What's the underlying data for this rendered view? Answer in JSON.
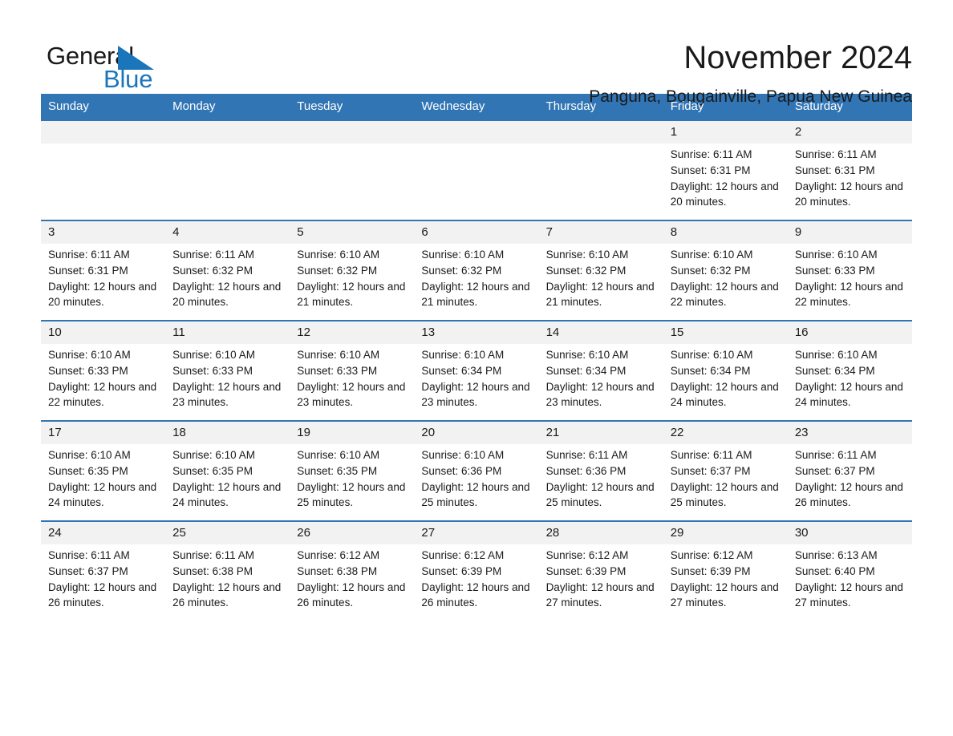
{
  "brand": {
    "name_part1": "General",
    "name_part2": "Blue",
    "triangle_color": "#1b75bb",
    "accent_color": "#3275b5"
  },
  "header": {
    "month_title": "November 2024",
    "location": "Panguna, Bougainville, Papua New Guinea"
  },
  "calendar": {
    "weekday_headers": [
      "Sunday",
      "Monday",
      "Tuesday",
      "Wednesday",
      "Thursday",
      "Friday",
      "Saturday"
    ],
    "weeks": [
      [
        {
          "day": "",
          "sunrise": "",
          "sunset": "",
          "daylight": ""
        },
        {
          "day": "",
          "sunrise": "",
          "sunset": "",
          "daylight": ""
        },
        {
          "day": "",
          "sunrise": "",
          "sunset": "",
          "daylight": ""
        },
        {
          "day": "",
          "sunrise": "",
          "sunset": "",
          "daylight": ""
        },
        {
          "day": "",
          "sunrise": "",
          "sunset": "",
          "daylight": ""
        },
        {
          "day": "1",
          "sunrise": "Sunrise: 6:11 AM",
          "sunset": "Sunset: 6:31 PM",
          "daylight": "Daylight: 12 hours and 20 minutes."
        },
        {
          "day": "2",
          "sunrise": "Sunrise: 6:11 AM",
          "sunset": "Sunset: 6:31 PM",
          "daylight": "Daylight: 12 hours and 20 minutes."
        }
      ],
      [
        {
          "day": "3",
          "sunrise": "Sunrise: 6:11 AM",
          "sunset": "Sunset: 6:31 PM",
          "daylight": "Daylight: 12 hours and 20 minutes."
        },
        {
          "day": "4",
          "sunrise": "Sunrise: 6:11 AM",
          "sunset": "Sunset: 6:32 PM",
          "daylight": "Daylight: 12 hours and 20 minutes."
        },
        {
          "day": "5",
          "sunrise": "Sunrise: 6:10 AM",
          "sunset": "Sunset: 6:32 PM",
          "daylight": "Daylight: 12 hours and 21 minutes."
        },
        {
          "day": "6",
          "sunrise": "Sunrise: 6:10 AM",
          "sunset": "Sunset: 6:32 PM",
          "daylight": "Daylight: 12 hours and 21 minutes."
        },
        {
          "day": "7",
          "sunrise": "Sunrise: 6:10 AM",
          "sunset": "Sunset: 6:32 PM",
          "daylight": "Daylight: 12 hours and 21 minutes."
        },
        {
          "day": "8",
          "sunrise": "Sunrise: 6:10 AM",
          "sunset": "Sunset: 6:32 PM",
          "daylight": "Daylight: 12 hours and 22 minutes."
        },
        {
          "day": "9",
          "sunrise": "Sunrise: 6:10 AM",
          "sunset": "Sunset: 6:33 PM",
          "daylight": "Daylight: 12 hours and 22 minutes."
        }
      ],
      [
        {
          "day": "10",
          "sunrise": "Sunrise: 6:10 AM",
          "sunset": "Sunset: 6:33 PM",
          "daylight": "Daylight: 12 hours and 22 minutes."
        },
        {
          "day": "11",
          "sunrise": "Sunrise: 6:10 AM",
          "sunset": "Sunset: 6:33 PM",
          "daylight": "Daylight: 12 hours and 23 minutes."
        },
        {
          "day": "12",
          "sunrise": "Sunrise: 6:10 AM",
          "sunset": "Sunset: 6:33 PM",
          "daylight": "Daylight: 12 hours and 23 minutes."
        },
        {
          "day": "13",
          "sunrise": "Sunrise: 6:10 AM",
          "sunset": "Sunset: 6:34 PM",
          "daylight": "Daylight: 12 hours and 23 minutes."
        },
        {
          "day": "14",
          "sunrise": "Sunrise: 6:10 AM",
          "sunset": "Sunset: 6:34 PM",
          "daylight": "Daylight: 12 hours and 23 minutes."
        },
        {
          "day": "15",
          "sunrise": "Sunrise: 6:10 AM",
          "sunset": "Sunset: 6:34 PM",
          "daylight": "Daylight: 12 hours and 24 minutes."
        },
        {
          "day": "16",
          "sunrise": "Sunrise: 6:10 AM",
          "sunset": "Sunset: 6:34 PM",
          "daylight": "Daylight: 12 hours and 24 minutes."
        }
      ],
      [
        {
          "day": "17",
          "sunrise": "Sunrise: 6:10 AM",
          "sunset": "Sunset: 6:35 PM",
          "daylight": "Daylight: 12 hours and 24 minutes."
        },
        {
          "day": "18",
          "sunrise": "Sunrise: 6:10 AM",
          "sunset": "Sunset: 6:35 PM",
          "daylight": "Daylight: 12 hours and 24 minutes."
        },
        {
          "day": "19",
          "sunrise": "Sunrise: 6:10 AM",
          "sunset": "Sunset: 6:35 PM",
          "daylight": "Daylight: 12 hours and 25 minutes."
        },
        {
          "day": "20",
          "sunrise": "Sunrise: 6:10 AM",
          "sunset": "Sunset: 6:36 PM",
          "daylight": "Daylight: 12 hours and 25 minutes."
        },
        {
          "day": "21",
          "sunrise": "Sunrise: 6:11 AM",
          "sunset": "Sunset: 6:36 PM",
          "daylight": "Daylight: 12 hours and 25 minutes."
        },
        {
          "day": "22",
          "sunrise": "Sunrise: 6:11 AM",
          "sunset": "Sunset: 6:37 PM",
          "daylight": "Daylight: 12 hours and 25 minutes."
        },
        {
          "day": "23",
          "sunrise": "Sunrise: 6:11 AM",
          "sunset": "Sunset: 6:37 PM",
          "daylight": "Daylight: 12 hours and 26 minutes."
        }
      ],
      [
        {
          "day": "24",
          "sunrise": "Sunrise: 6:11 AM",
          "sunset": "Sunset: 6:37 PM",
          "daylight": "Daylight: 12 hours and 26 minutes."
        },
        {
          "day": "25",
          "sunrise": "Sunrise: 6:11 AM",
          "sunset": "Sunset: 6:38 PM",
          "daylight": "Daylight: 12 hours and 26 minutes."
        },
        {
          "day": "26",
          "sunrise": "Sunrise: 6:12 AM",
          "sunset": "Sunset: 6:38 PM",
          "daylight": "Daylight: 12 hours and 26 minutes."
        },
        {
          "day": "27",
          "sunrise": "Sunrise: 6:12 AM",
          "sunset": "Sunset: 6:39 PM",
          "daylight": "Daylight: 12 hours and 26 minutes."
        },
        {
          "day": "28",
          "sunrise": "Sunrise: 6:12 AM",
          "sunset": "Sunset: 6:39 PM",
          "daylight": "Daylight: 12 hours and 27 minutes."
        },
        {
          "day": "29",
          "sunrise": "Sunrise: 6:12 AM",
          "sunset": "Sunset: 6:39 PM",
          "daylight": "Daylight: 12 hours and 27 minutes."
        },
        {
          "day": "30",
          "sunrise": "Sunrise: 6:13 AM",
          "sunset": "Sunset: 6:40 PM",
          "daylight": "Daylight: 12 hours and 27 minutes."
        }
      ]
    ]
  }
}
